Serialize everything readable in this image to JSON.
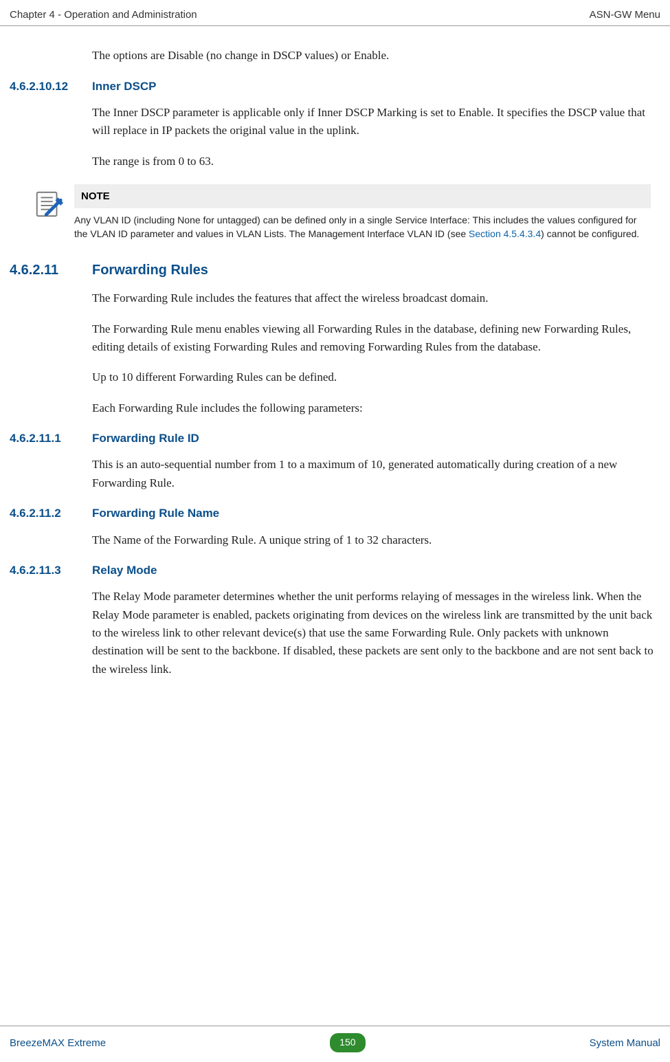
{
  "header": {
    "left": "Chapter 4 - Operation and Administration",
    "right": "ASN-GW Menu"
  },
  "intro_body": "The options are Disable (no change in DSCP values) or Enable.",
  "s1": {
    "num": "4.6.2.10.12",
    "title": "Inner DSCP",
    "p1": "The Inner DSCP parameter is applicable only if Inner DSCP Marking is set to Enable. It specifies the DSCP value that will replace in IP packets the original value in the uplink.",
    "p2": "The range is from 0 to 63."
  },
  "note": {
    "label": "NOTE",
    "text1": "Any VLAN ID (including None for untagged) can be defined only in a single Service Interface: This includes the values configured for the VLAN ID parameter and values in VLAN Lists. The Management Interface VLAN ID (see ",
    "link": "Section 4.5.4.3.4",
    "text2": ") cannot be configured."
  },
  "s2": {
    "num": "4.6.2.11",
    "title": "Forwarding Rules",
    "p1": "The Forwarding Rule includes the features that affect the wireless broadcast domain.",
    "p2": "The Forwarding Rule menu enables viewing all Forwarding Rules in the database, defining new Forwarding Rules, editing details of existing Forwarding Rules and removing Forwarding Rules from the database.",
    "p3": "Up to 10 different Forwarding Rules can be defined.",
    "p4": "Each Forwarding Rule includes the following parameters:"
  },
  "s3": {
    "num": "4.6.2.11.1",
    "title": "Forwarding Rule ID",
    "p1": "This is an auto-sequential number from 1 to a maximum of 10, generated automatically during creation of a new Forwarding Rule."
  },
  "s4": {
    "num": "4.6.2.11.2",
    "title": "Forwarding Rule Name",
    "p1": "The Name of the Forwarding Rule. A unique string of 1 to 32 characters."
  },
  "s5": {
    "num": "4.6.2.11.3",
    "title": "Relay Mode",
    "p1": "The Relay Mode parameter determines whether the unit performs relaying of messages in the wireless link. When the Relay Mode parameter is enabled, packets originating from devices on the wireless link are transmitted by the unit back to the wireless link to other relevant device(s) that use the same Forwarding Rule. Only packets with unknown destination will be sent to the backbone. If disabled, these packets are sent only to the backbone and are not sent back to the wireless link."
  },
  "footer": {
    "left": "BreezeMAX Extreme",
    "page": "150",
    "right": "System Manual"
  }
}
